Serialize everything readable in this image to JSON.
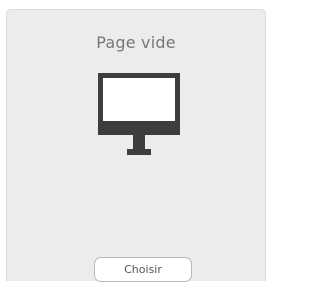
{
  "card": {
    "title": "Page vide",
    "icon": "monitor-icon",
    "choose_label": "Choisir"
  },
  "colors": {
    "card_background": "#ececec",
    "monitor": "#3d3d3d",
    "title_text": "#777777"
  }
}
